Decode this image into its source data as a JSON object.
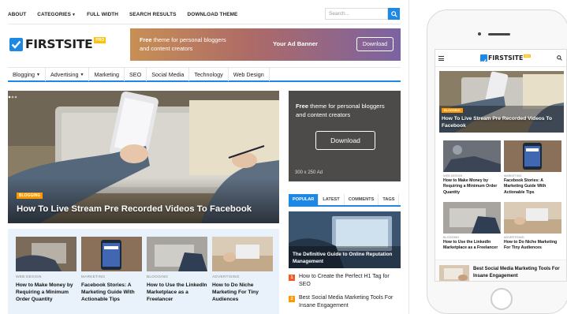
{
  "desktop": {
    "topnav": {
      "items": [
        "ABOUT",
        "CATEGORIES",
        "FULL WIDTH",
        "SEARCH RESULTS",
        "DOWNLOAD THEME"
      ],
      "search_placeholder": "Search..."
    },
    "logo": {
      "text": "FIRSTSITE",
      "badge": "PRO"
    },
    "banner": {
      "text_bold": "Free",
      "text_rest": " theme for personal bloggers",
      "text_line2": "and content creators",
      "ad_label": "Your Ad Banner",
      "button": "Download"
    },
    "mainnav": [
      "Blogging",
      "Advertising",
      "Marketing",
      "SEO",
      "Social Media",
      "Technology",
      "Web Design"
    ],
    "hero": {
      "category": "BLOGGING",
      "title": "How To Live Stream Pre Recorded Videos To Facebook"
    },
    "cards": [
      {
        "category": "WEB DESIGN",
        "title": "How to Make Money by Requiring a Minimum Order Quantity"
      },
      {
        "category": "MARKETING",
        "title": "Facebook Stories: A Marketing Guide With Actionable Tips"
      },
      {
        "category": "BLOGGING",
        "title": "How to Use the LinkedIn Marketplace as a Freelancer"
      },
      {
        "category": "ADVERTISING",
        "title": "How to Do Niche Marketing For Tiny Audiences"
      }
    ],
    "side_ad": {
      "text_bold": "Free",
      "text_rest": " theme for personal bloggers",
      "text_line2": "and content creators",
      "button": "Download",
      "size_label": "300 x 250 Ad"
    },
    "tabs": [
      "POPULAR",
      "LATEST",
      "COMMENTS",
      "TAGS"
    ],
    "popular": {
      "featured_title": "The Definitive Guide to Online Reputation Management",
      "items": [
        {
          "num": "1",
          "title": "How to Create the Perfect H1 Tag for SEO"
        },
        {
          "num": "2",
          "title": "Best Social Media Marketing Tools For Insane Engagement"
        }
      ]
    }
  },
  "mobile": {
    "logo": {
      "text": "FIRSTSITE",
      "badge": "PRO"
    },
    "hero": {
      "category": "BLOGGING",
      "title": "How To Live Stream Pre Recorded Videos To Facebook"
    },
    "cards": [
      {
        "category": "WEB DESIGN",
        "title": "How to Make Money by Requiring a Minimum Order Quantity"
      },
      {
        "category": "MARKETING",
        "title": "Facebook Stories: A Marketing Guide With Actionable Tips"
      },
      {
        "category": "BLOGGING",
        "title": "How to Use the LinkedIn Marketplace as a Freelancer"
      },
      {
        "category": "ADVERTISING",
        "title": "How to Do Niche Marketing For Tiny Audiences"
      }
    ],
    "list_item": "Best Social Media Marketing Tools For Insane Engagement"
  },
  "colors": {
    "accent": "#1e88e5",
    "badge": "#ff9800",
    "number_red": "#f05a28"
  }
}
